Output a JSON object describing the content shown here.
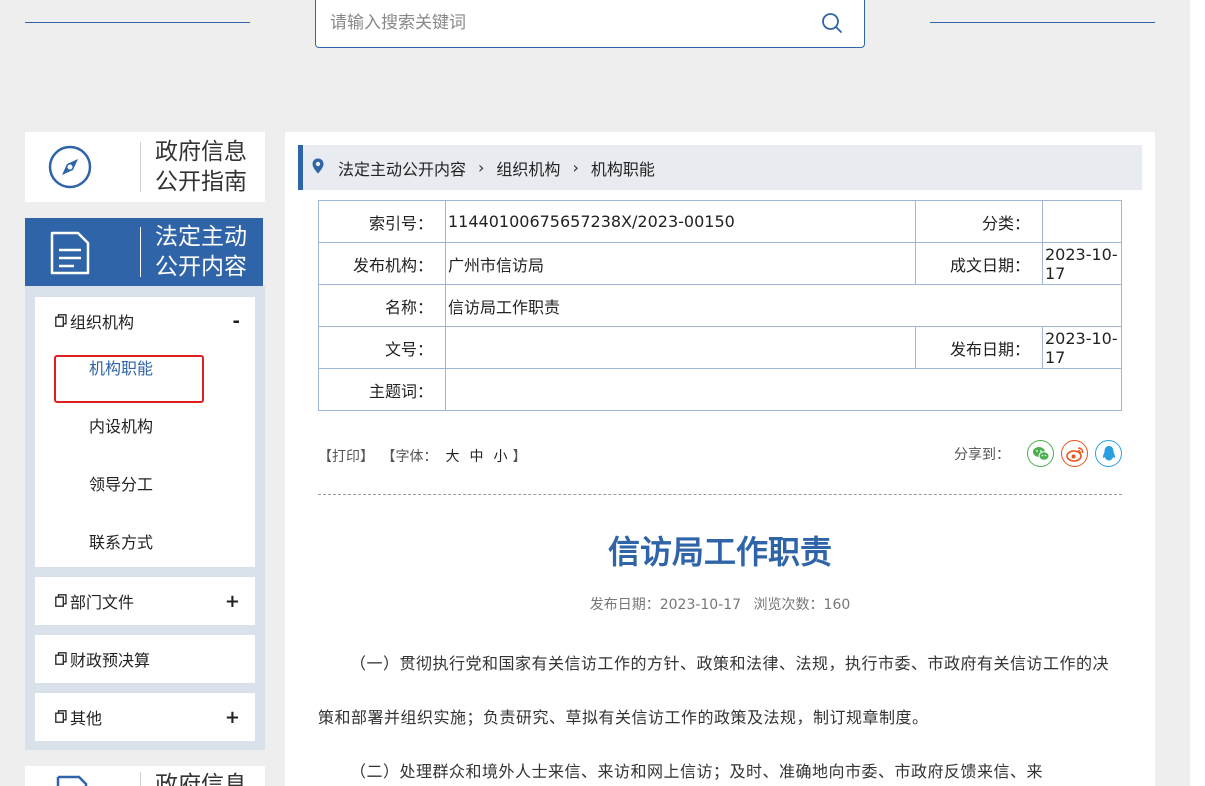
{
  "search": {
    "placeholder": "请输入搜索关键词"
  },
  "sidebar": {
    "guide_title_1": "政府信息",
    "guide_title_2": "公开指南",
    "content_title_1": "法定主动",
    "content_title_2": "公开内容",
    "groups": [
      {
        "label": "组织机构",
        "toggle": "-",
        "items": [
          "机构职能",
          "内设机构",
          "领导分工",
          "联系方式"
        ]
      },
      {
        "label": "部门文件",
        "toggle": "+"
      },
      {
        "label": "财政预决算",
        "toggle": ""
      },
      {
        "label": "其他",
        "toggle": "+"
      }
    ],
    "footer_title_1": "政府信息"
  },
  "breadcrumb": [
    "法定主动公开内容",
    "组织机构",
    "机构职能"
  ],
  "meta": {
    "index_label": "索引号：",
    "index_value": "11440100675657238X/2023-00150",
    "category_label": "分类：",
    "category_value": "",
    "publisher_label": "发布机构：",
    "publisher_value": "广州市信访局",
    "written_date_label": "成文日期：",
    "written_date_value": "2023-10-17",
    "name_label": "名称：",
    "name_value": "信访局工作职责",
    "doc_no_label": "文号：",
    "doc_no_value": "",
    "publish_date_label": "发布日期：",
    "publish_date_value": "2023-10-17",
    "keywords_label": "主题词：",
    "keywords_value": ""
  },
  "toolbar": {
    "print": "【打印】",
    "font_prefix": "【字体：",
    "font_large": "大",
    "font_medium": "中",
    "font_small": "小",
    "font_suffix": "】",
    "share_label": "分享到："
  },
  "article": {
    "title": "信访局工作职责",
    "publish_date": "发布日期：2023-10-17",
    "views": "浏览次数：160",
    "para1": "（一）贯彻执行党和国家有关信访工作的方针、政策和法律、法规，执行市委、市政府有关信访工作的决策和部署并组织实施；负责研究、草拟有关信访工作的政策及法规，制订规章制度。",
    "para2": "（二）处理群众和境外人士来信、来访和网上信访；及时、准确地向市委、市政府反馈来信、来"
  },
  "colors": {
    "primary": "#2f64a8",
    "highlight": "#e02020"
  }
}
